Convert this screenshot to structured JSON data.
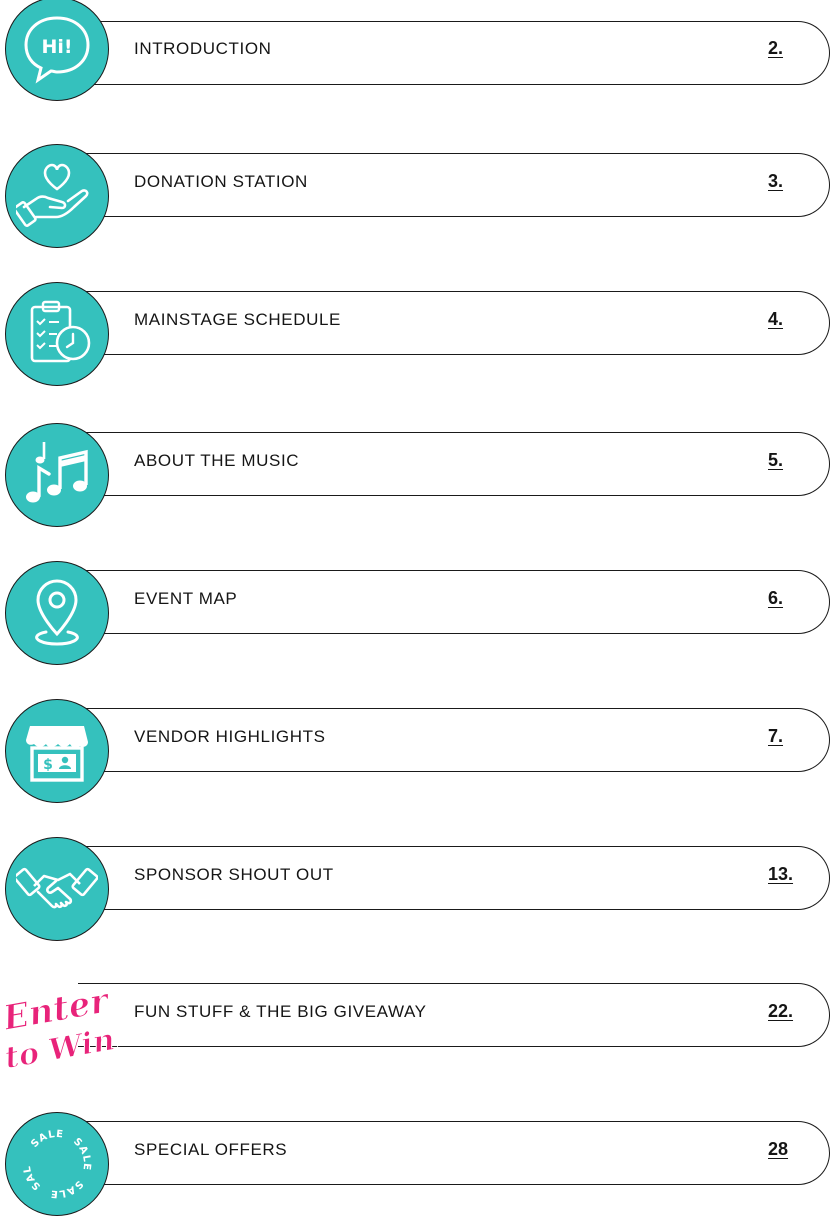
{
  "toc": {
    "items": [
      {
        "label": "INTRODUCTION",
        "page": "2.",
        "icon": "hi-speech-bubble-icon"
      },
      {
        "label": "DONATION STATION",
        "page": "3.",
        "icon": "heart-hand-icon"
      },
      {
        "label": "MAINSTAGE SCHEDULE",
        "page": "4.",
        "icon": "clipboard-clock-icon"
      },
      {
        "label": "ABOUT THE MUSIC",
        "page": "5.",
        "icon": "music-notes-icon"
      },
      {
        "label": "EVENT MAP",
        "page": "6.",
        "icon": "map-pin-icon"
      },
      {
        "label": "VENDOR HIGHLIGHTS",
        "page": "7.",
        "icon": "storefront-icon"
      },
      {
        "label": "SPONSOR SHOUT OUT",
        "page": "13.",
        "icon": "handshake-icon"
      },
      {
        "label": "FUN STUFF & THE BIG GIVEAWAY",
        "page": "22.",
        "icon": "enter-to-win-icon"
      },
      {
        "label": "SPECIAL OFFERS",
        "page": "28",
        "icon": "sale-badge-icon"
      }
    ],
    "icon_texts": {
      "hi": "Hi!",
      "sale": "SALE",
      "enter": "Enter",
      "to_win": "to Win!"
    },
    "colors": {
      "teal": "#35c1bd",
      "pink": "#e8237a",
      "outline": "#1a1a1a"
    }
  }
}
